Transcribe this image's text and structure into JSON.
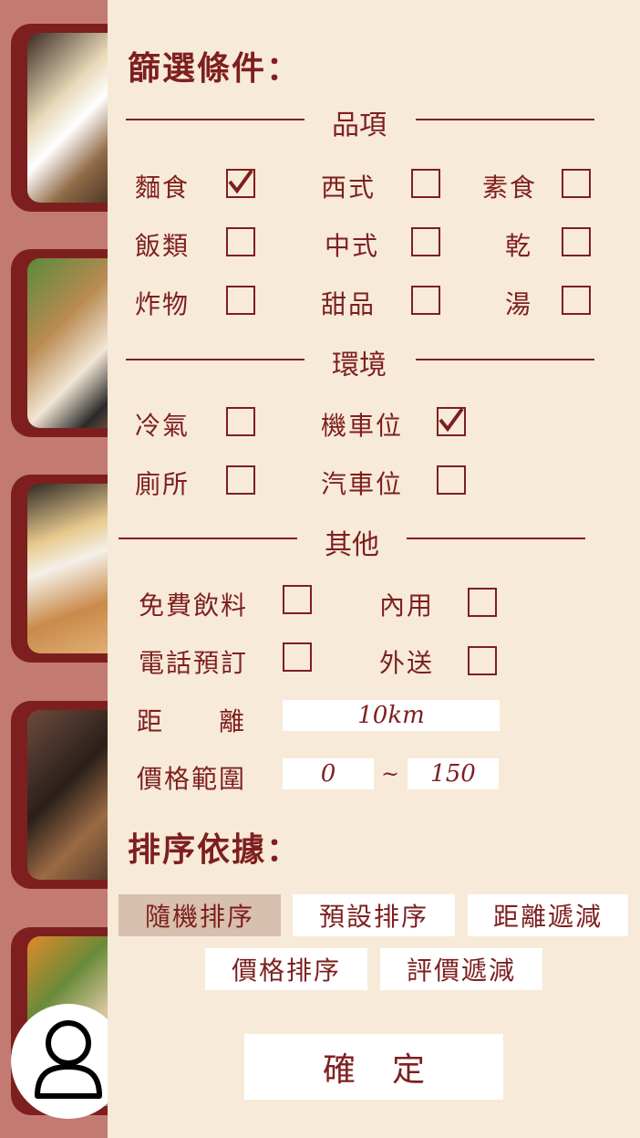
{
  "filter": {
    "heading": "篩選條件：",
    "sections": {
      "category": {
        "title": "品項",
        "items": [
          {
            "label": "麵食",
            "checked": true
          },
          {
            "label": "西式",
            "checked": false
          },
          {
            "label": "素食",
            "checked": false
          },
          {
            "label": "飯類",
            "checked": false
          },
          {
            "label": "中式",
            "checked": false
          },
          {
            "label": "乾",
            "checked": false
          },
          {
            "label": "炸物",
            "checked": false
          },
          {
            "label": "甜品",
            "checked": false
          },
          {
            "label": "湯",
            "checked": false
          }
        ]
      },
      "environment": {
        "title": "環境",
        "items": [
          {
            "label": "冷氣",
            "checked": false
          },
          {
            "label": "機車位",
            "checked": true
          },
          {
            "label": "廁所",
            "checked": false
          },
          {
            "label": "汽車位",
            "checked": false
          }
        ]
      },
      "other": {
        "title": "其他",
        "items": [
          {
            "label": "免費飲料",
            "checked": false
          },
          {
            "label": "內用",
            "checked": false
          },
          {
            "label": "電話預訂",
            "checked": false
          },
          {
            "label": "外送",
            "checked": false
          }
        ],
        "distance": {
          "label": "距　　離",
          "value": "10km"
        },
        "price": {
          "label": "價格範圍",
          "min": "0",
          "separator": "~",
          "max": "150"
        }
      }
    }
  },
  "sort": {
    "heading": "排序依據：",
    "options": [
      {
        "label": "隨機排序",
        "active": true
      },
      {
        "label": "預設排序",
        "active": false
      },
      {
        "label": "距離遞減",
        "active": false
      },
      {
        "label": "價格排序",
        "active": false
      },
      {
        "label": "評價遞減",
        "active": false
      }
    ]
  },
  "confirm_label": "確定",
  "icons": {
    "check": "checkmark-icon",
    "user": "user-icon"
  },
  "colors": {
    "accent": "#7e1f1f",
    "panel": "#f7ead9",
    "backdrop": "#c37a72",
    "active_sort": "#d7c0ad"
  }
}
